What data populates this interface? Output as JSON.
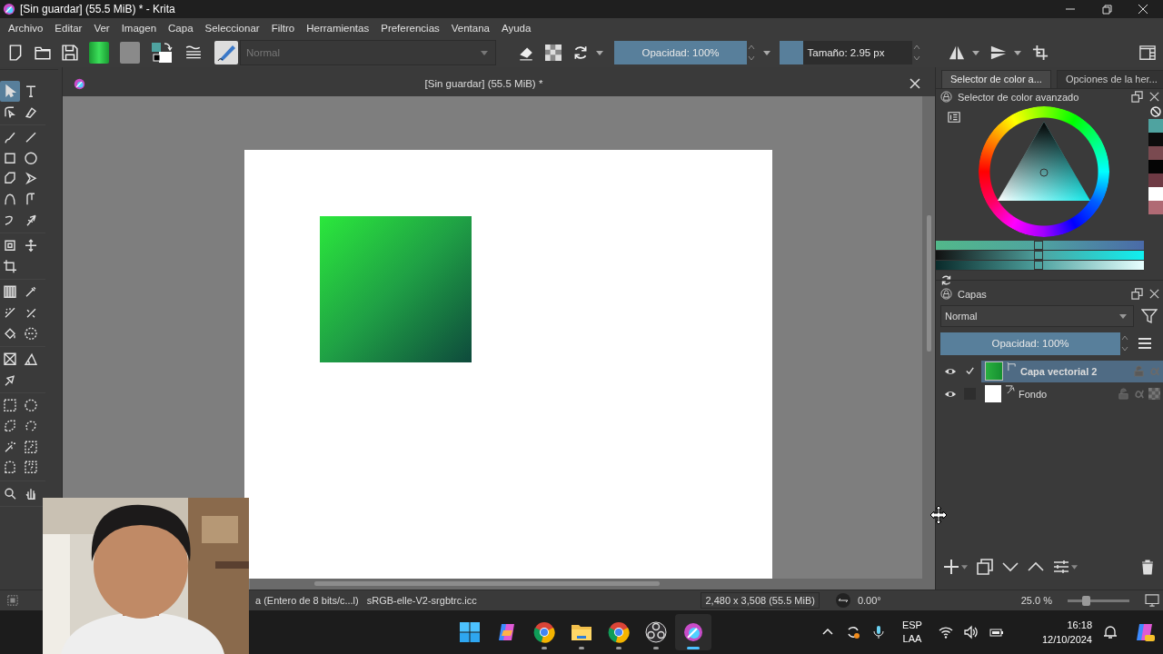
{
  "window": {
    "title": "[Sin guardar]  (55.5 MiB) * - Krita"
  },
  "menu": [
    "Archivo",
    "Editar",
    "Ver",
    "Imagen",
    "Capa",
    "Seleccionar",
    "Filtro",
    "Herramientas",
    "Preferencias",
    "Ventana",
    "Ayuda"
  ],
  "toolbar": {
    "blend_mode": "Normal",
    "blend_disabled": true,
    "opacity": {
      "label": "Opacidad: 100%",
      "level": 1
    },
    "size": {
      "label": "Tamaño: 2.95 px",
      "level": 0.18
    }
  },
  "toolbox": [
    {
      "tools": [
        {
          "kind": "pointer",
          "selected": true
        },
        {
          "kind": "text",
          "selected": false
        },
        {
          "kind": "edit-shapes",
          "selected": false
        },
        {
          "kind": "calligraphy",
          "selected": false
        }
      ]
    },
    {
      "tools": [
        {
          "kind": "brush",
          "selected": false
        },
        {
          "kind": "line",
          "selected": false
        },
        {
          "kind": "rect",
          "selected": false
        },
        {
          "kind": "ellipse",
          "selected": false
        },
        {
          "kind": "polygon",
          "selected": false
        },
        {
          "kind": "polyline",
          "selected": false
        },
        {
          "kind": "bezier",
          "selected": false
        },
        {
          "kind": "freehand-path",
          "selected": false
        },
        {
          "kind": "dynamic-brush",
          "selected": false
        },
        {
          "kind": "multibrush",
          "selected": false
        }
      ]
    },
    {
      "tools": [
        {
          "kind": "transform",
          "selected": false
        },
        {
          "kind": "move",
          "selected": false
        },
        {
          "kind": "crop",
          "selected": false
        }
      ]
    },
    {
      "tools": [
        {
          "kind": "gradient",
          "selected": false
        },
        {
          "kind": "picker",
          "selected": false
        },
        {
          "kind": "colorize",
          "selected": false
        },
        {
          "kind": "smart-patch",
          "selected": false
        },
        {
          "kind": "fill",
          "selected": false
        },
        {
          "kind": "enclose-fill",
          "selected": false
        }
      ]
    },
    {
      "tools": [
        {
          "kind": "assistant",
          "selected": false
        },
        {
          "kind": "measure",
          "selected": false
        },
        {
          "kind": "reference",
          "selected": false
        }
      ]
    },
    {
      "tools": [
        {
          "kind": "rect-select",
          "selected": false
        },
        {
          "kind": "ellipse-select",
          "selected": false
        },
        {
          "kind": "polygon-select",
          "selected": false
        },
        {
          "kind": "freehand-select",
          "selected": false
        },
        {
          "kind": "contiguous-select",
          "selected": false
        },
        {
          "kind": "similar-select",
          "selected": false
        },
        {
          "kind": "bezier-select",
          "selected": false
        },
        {
          "kind": "magnetic-select",
          "selected": false
        }
      ]
    },
    {
      "tools": [
        {
          "kind": "zoom",
          "selected": false
        },
        {
          "kind": "pan",
          "selected": false
        }
      ]
    }
  ],
  "document": {
    "tab_title": "[Sin guardar]  (55.5 MiB) *"
  },
  "dock_tabs": [
    {
      "label": "Selector de color a...",
      "selected": true
    },
    {
      "label": "Opciones de la her...",
      "selected": false
    }
  ],
  "color_selector": {
    "title": "Selector de color avanzado",
    "sliders": [
      {
        "level": 0.49
      },
      {
        "level": 0.49
      },
      {
        "level": 0.49
      }
    ],
    "recent_colors": [
      {
        "color": "#4fa3a0"
      },
      {
        "color": "#0c0c0c"
      },
      {
        "color": "#7a4a50"
      },
      {
        "color": "#050505"
      },
      {
        "color": "#6e3a44"
      },
      {
        "color": "#ffffff"
      },
      {
        "color": "#b06a74"
      }
    ]
  },
  "layers": {
    "title": "Capas",
    "blend_mode": "Normal",
    "opacity": {
      "label": "Opacidad:  100%",
      "level": 1
    },
    "items": [
      {
        "name": "Capa vectorial 2",
        "kind": "vector",
        "visible": true,
        "checked": true,
        "selected": true
      },
      {
        "name": "Fondo",
        "kind": "paint",
        "visible": true,
        "checked": false,
        "selected": false
      }
    ]
  },
  "status_bar": {
    "color_space": "a (Entero de 8 bits/c...l)",
    "profile": "sRGB-elle-V2-srgbtrc.icc",
    "image_size": "2,480 x 3,508 (55.5 MiB)",
    "rotation": "0.00°",
    "zoom": "25.0 %",
    "zoom_slider": {
      "level": 0.3
    }
  },
  "taskbar": {
    "apps": [
      {
        "kind": "start",
        "running": false,
        "selected": false
      },
      {
        "kind": "copilot",
        "running": false,
        "selected": false
      },
      {
        "kind": "browser",
        "running": true,
        "selected": false
      },
      {
        "kind": "folder",
        "running": true,
        "selected": false
      },
      {
        "kind": "browser",
        "running": true,
        "selected": false
      },
      {
        "kind": "obs",
        "running": true,
        "selected": false
      },
      {
        "kind": "krita",
        "running": true,
        "selected": true
      }
    ],
    "language": "ESP",
    "layout": "LAA",
    "time": "16:18",
    "date": "12/10/2024"
  }
}
